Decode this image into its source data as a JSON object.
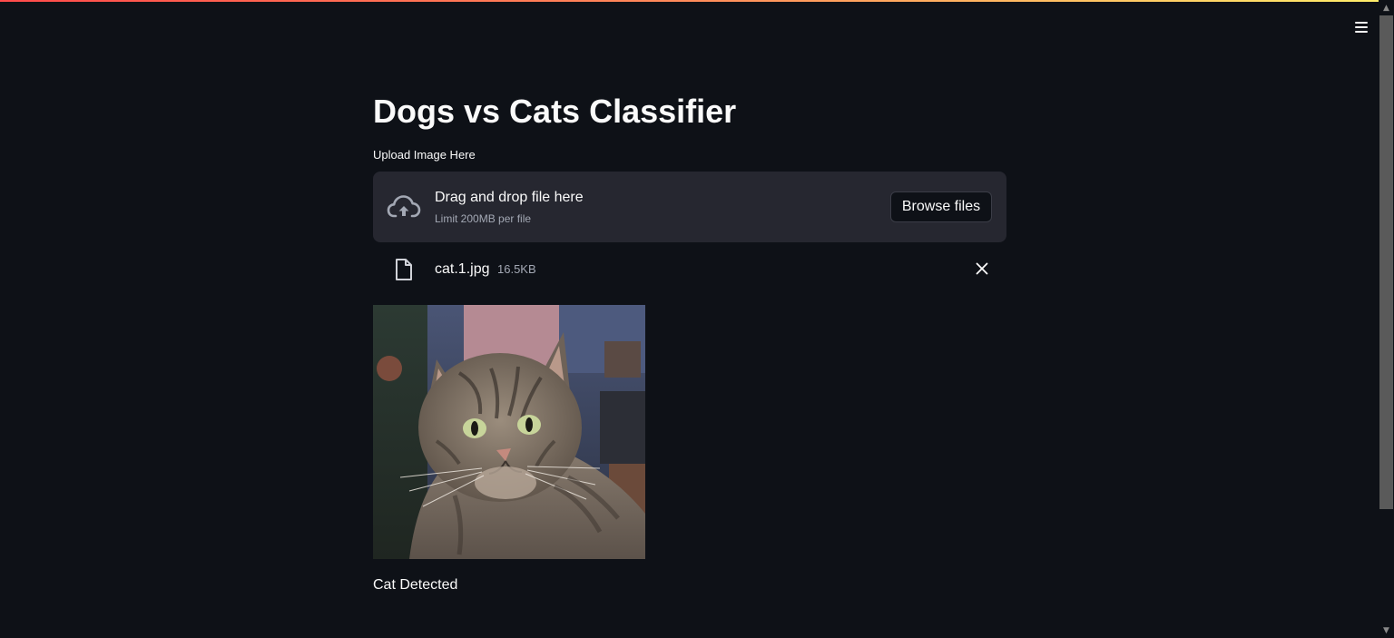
{
  "app": {
    "title": "Dogs vs Cats Classifier",
    "accent_gradient": [
      "#ff4b4b",
      "#ff8c5a",
      "#fff06a"
    ],
    "background": "#0e1117",
    "menu_icon": "hamburger-menu-icon"
  },
  "uploader": {
    "label": "Upload Image Here",
    "drop_title": "Drag and drop file here",
    "drop_limit": "Limit 200MB per file",
    "browse_label": "Browse files",
    "upload_icon": "cloud-upload-icon",
    "background": "#262730"
  },
  "uploaded_file": {
    "name": "cat.1.jpg",
    "size": "16.5KB",
    "file_icon": "file-icon",
    "remove_icon": "close-icon"
  },
  "preview": {
    "subject": "tabby cat photo"
  },
  "result": {
    "text": "Cat Detected"
  }
}
